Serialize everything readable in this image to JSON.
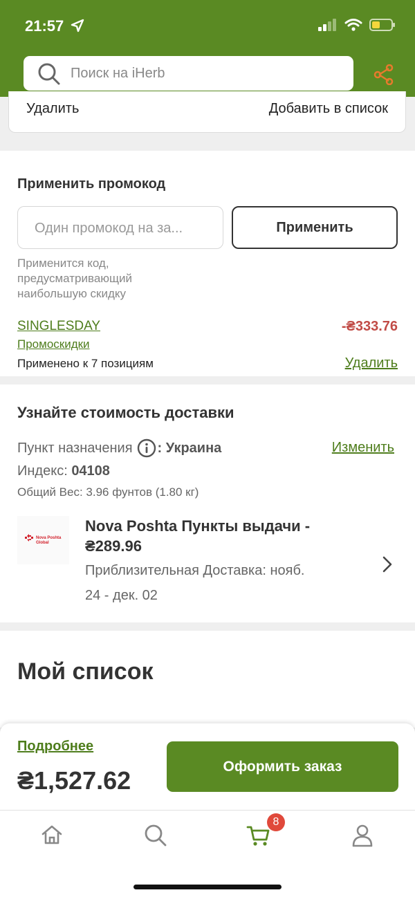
{
  "status_bar": {
    "time": "21:57"
  },
  "search": {
    "placeholder": "Поиск на iHerb"
  },
  "cart_item_actions": {
    "remove_label": "Удалить",
    "add_to_list_label": "Добавить в список"
  },
  "promo": {
    "title": "Применить промокод",
    "input_placeholder": "Один промокод на за...",
    "apply_label": "Применить",
    "hint": "Применится код, предусматривающий наибольшую скидку",
    "code": "SINGLESDAY",
    "discount": "-₴333.76",
    "promo_link": "Промоскидки",
    "applied_text": "Применено к 7 позициям",
    "remove_label": "Удалить"
  },
  "shipping": {
    "title": "Узнайте стоимость доставки",
    "destination_label": "Пункт назначения",
    "destination_value": ": Украина",
    "change_label": "Изменить",
    "zip_label": "Индекс: ",
    "zip_value": "04108",
    "weight": "Общий Вес: 3.96 фунтов (1.80 кг)",
    "carrier_name": "Nova Poshta Пункты выдачи - ₴289.96",
    "eta_line1": "Приблизительная Доставка: нояб.",
    "eta_line2": "24 - дек. 02",
    "logo_text_1": "Nova Poshta",
    "logo_text_2": "Global"
  },
  "my_list": {
    "title": "Мой список"
  },
  "checkout": {
    "details_label": "Подробнее",
    "total": "₴1,527.62",
    "order_label": "Оформить заказ"
  },
  "tab_bar": {
    "items": [
      {
        "icon": "home-icon"
      },
      {
        "icon": "search-icon"
      },
      {
        "icon": "cart-icon",
        "badge": "8"
      },
      {
        "icon": "account-icon"
      }
    ]
  },
  "colors": {
    "brand_green": "#5a8a23",
    "link_green": "#4e7d1c",
    "discount_red": "#c14b46",
    "badge_red": "#e0493b",
    "share_orange": "#e87a2d"
  }
}
